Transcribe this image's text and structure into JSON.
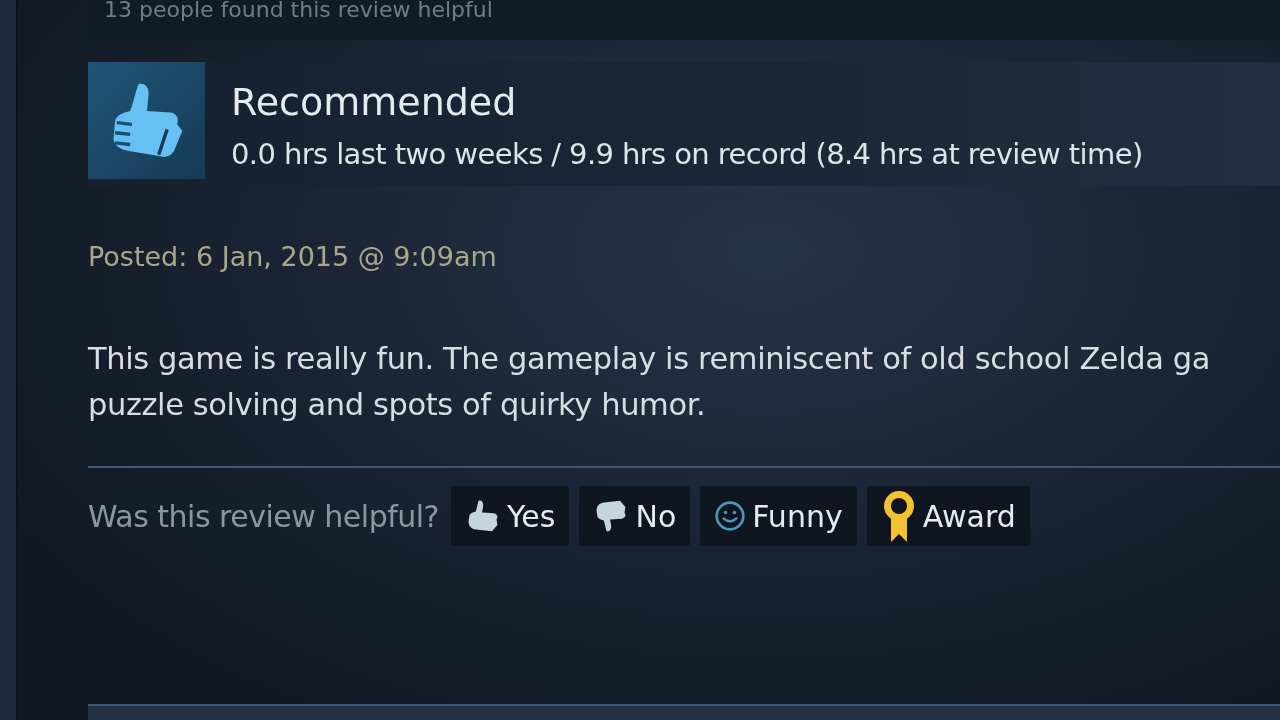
{
  "helpful_count": "13 people found this review helpful",
  "review": {
    "verdict": "Recommended",
    "recommended": true,
    "hours": "0.0 hrs last two weeks / 9.9 hrs on record (8.4 hrs at review time)",
    "posted": "Posted: 6 Jan, 2015 @ 9:09am",
    "body": [
      "This game is really fun. The gameplay is reminiscent of old school Zelda ga",
      "puzzle solving and spots of quirky humor."
    ]
  },
  "helpful_prompt": "Was this review helpful?",
  "buttons": [
    {
      "kind": "yes",
      "label": "Yes"
    },
    {
      "kind": "no",
      "label": "No"
    },
    {
      "kind": "funny",
      "label": "Funny"
    },
    {
      "kind": "award",
      "label": "Award"
    }
  ]
}
